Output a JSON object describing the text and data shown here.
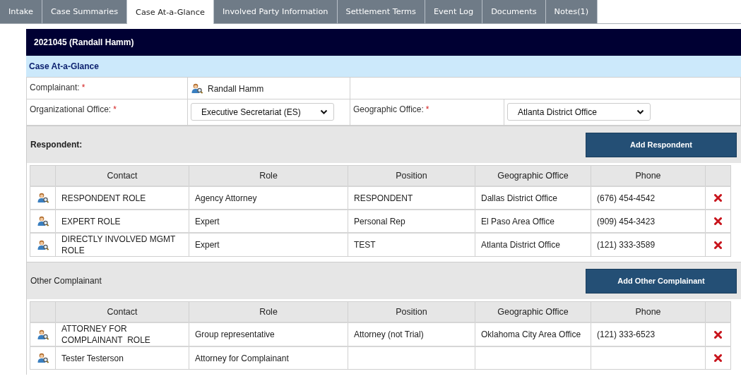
{
  "tabs": [
    {
      "label": "Intake",
      "selected": false
    },
    {
      "label": "Case Summaries",
      "selected": false
    },
    {
      "label": "Case At-a-Glance",
      "selected": true
    },
    {
      "label": "Involved Party Information",
      "selected": false
    },
    {
      "label": "Settlement Terms",
      "selected": false
    },
    {
      "label": "Event Log",
      "selected": false
    },
    {
      "label": "Documents",
      "selected": false
    },
    {
      "label": "Notes(1)",
      "selected": false
    }
  ],
  "case_header": {
    "title": "2021045 (Randall Hamm)"
  },
  "section_title": "Case At-a-Glance",
  "form": {
    "complainant": {
      "label": "Complainant:",
      "required_mark": "*",
      "value": "Randall Hamm"
    },
    "organizational_office": {
      "label": "Organizational Office:",
      "required_mark": "*",
      "value": "Executive Secretariat (ES)"
    },
    "geographic_office": {
      "label": "Geographic Office:",
      "required_mark": "*",
      "value": "Atlanta District Office"
    }
  },
  "sections": [
    {
      "title": "Respondent:",
      "title_bold": true,
      "button": "Add Respondent",
      "columns": [
        "Contact",
        "Role",
        "Position",
        "Geographic Office",
        "Phone"
      ],
      "rows": [
        {
          "contact": "RESPONDENT ROLE",
          "role": "Agency Attorney",
          "position": "RESPONDENT",
          "geographic_office": "Dallas District Office",
          "phone": "(676) 454-4542"
        },
        {
          "contact": "EXPERT ROLE",
          "role": "Expert",
          "position": "Personal Rep",
          "geographic_office": "El Paso Area Office",
          "phone": "(909) 454-3423"
        },
        {
          "contact": "DIRECTLY INVOLVED MGMT ROLE",
          "role": "Expert",
          "position": "TEST",
          "geographic_office": "Atlanta District Office",
          "phone": "(121) 333-3589"
        }
      ]
    },
    {
      "title": "Other Complainant",
      "title_bold": false,
      "button": "Add Other Complainant",
      "columns": [
        "Contact",
        "Role",
        "Position",
        "Geographic Office",
        "Phone"
      ],
      "rows": [
        {
          "contact": "ATTORNEY FOR COMPLAINANT  ROLE",
          "role": "Group representative",
          "position": "Attorney (not Trial)",
          "geographic_office": "Oklahoma City Area Office",
          "phone": "(121) 333-6523"
        },
        {
          "contact": "Tester Testerson",
          "role": "Attorney for Complainant"
        }
      ]
    }
  ]
}
